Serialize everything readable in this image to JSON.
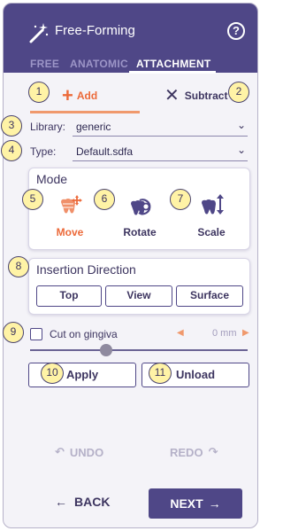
{
  "header": {
    "title": "Free-Forming",
    "help_icon": "?",
    "tabs": [
      "FREE",
      "ANATOMIC",
      "ATTACHMENT"
    ],
    "active_tab": "ATTACHMENT",
    "colors": {
      "header": "#4f4787",
      "accent": "#ec6a3a"
    }
  },
  "mode_toggle": {
    "add_label": "Add",
    "subtract_label": "Subtract",
    "active": "Add"
  },
  "fields": {
    "library_label": "Library:",
    "library_value": "generic",
    "type_label": "Type:",
    "type_value": "Default.sdfa"
  },
  "mode": {
    "title": "Mode",
    "items": [
      {
        "label": "Move",
        "icon": "move-tooth-icon",
        "active": true
      },
      {
        "label": "Rotate",
        "icon": "rotate-tooth-icon",
        "active": false
      },
      {
        "label": "Scale",
        "icon": "scale-tooth-icon",
        "active": false
      }
    ]
  },
  "insertion": {
    "title": "Insertion Direction",
    "buttons": [
      "Top",
      "View",
      "Surface"
    ]
  },
  "cut": {
    "label": "Cut on gingiva",
    "checked": false,
    "value": "0 mm",
    "slider_fraction": 0.34
  },
  "actions": {
    "apply": "Apply",
    "unload": "Unload",
    "undo": "UNDO",
    "redo": "REDO",
    "back": "BACK",
    "next": "NEXT"
  },
  "badges": [
    "1",
    "2",
    "3",
    "4",
    "5",
    "6",
    "7",
    "8",
    "9",
    "10",
    "11"
  ]
}
